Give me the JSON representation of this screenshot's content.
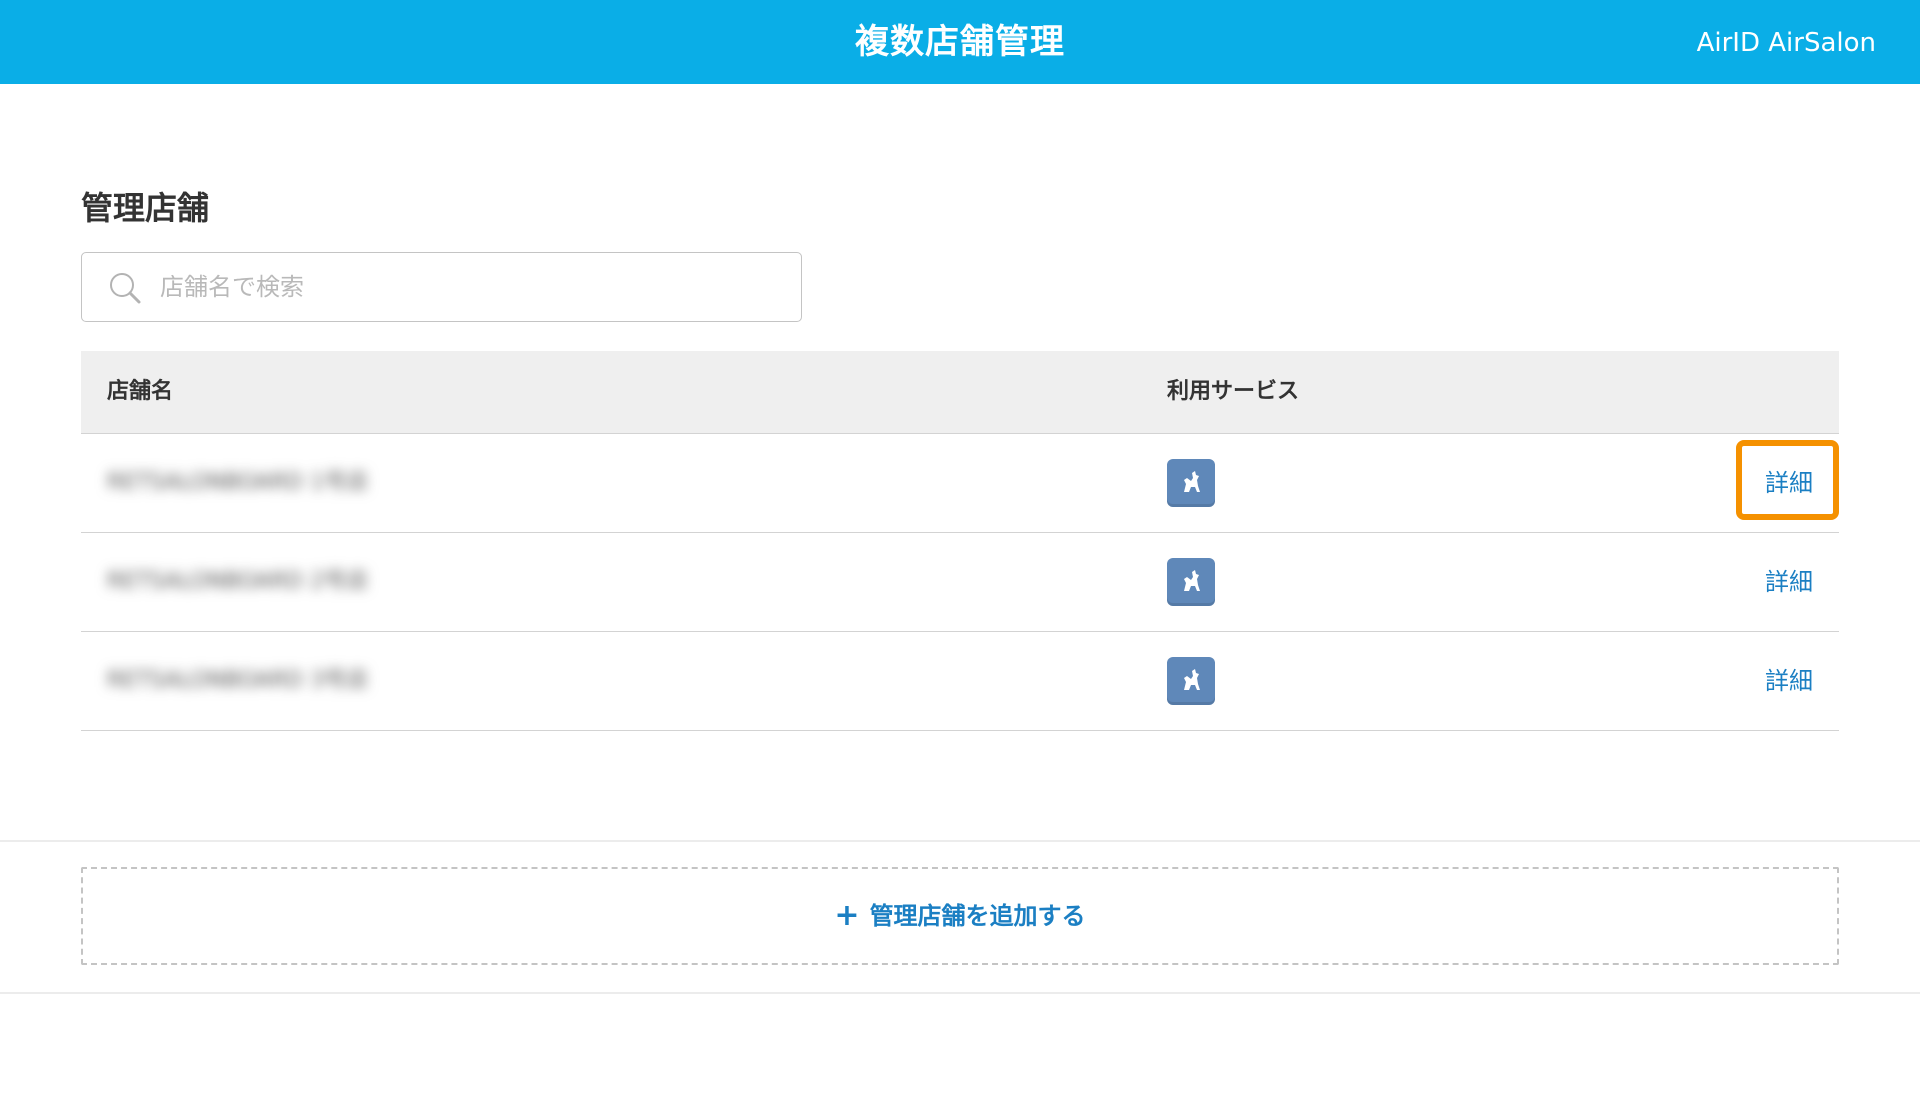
{
  "header": {
    "title": "複数店舗管理",
    "user_label": "AirID AirSalon"
  },
  "section": {
    "title": "管理店舗"
  },
  "search": {
    "placeholder": "店舗名で検索",
    "value": "",
    "icon": "search-icon"
  },
  "table": {
    "columns": {
      "name": "店舗名",
      "service": "利用サービス"
    },
    "rows": [
      {
        "name": "RETSALONBOARD 1号店",
        "service_icon": "airsalon-service-icon",
        "detail_label": "詳細",
        "highlighted": true
      },
      {
        "name": "RETSALONBOARD 2号店",
        "service_icon": "airsalon-service-icon",
        "detail_label": "詳細",
        "highlighted": false
      },
      {
        "name": "RETSALONBOARD 3号店",
        "service_icon": "airsalon-service-icon",
        "detail_label": "詳細",
        "highlighted": false
      }
    ]
  },
  "footer": {
    "add_label": "管理店舗を追加する",
    "add_icon": "plus-icon"
  },
  "colors": {
    "header_bg": "#0aaee7",
    "link": "#1b7fc3",
    "highlight": "#f59100",
    "service_icon_bg": "#5f88b9"
  }
}
